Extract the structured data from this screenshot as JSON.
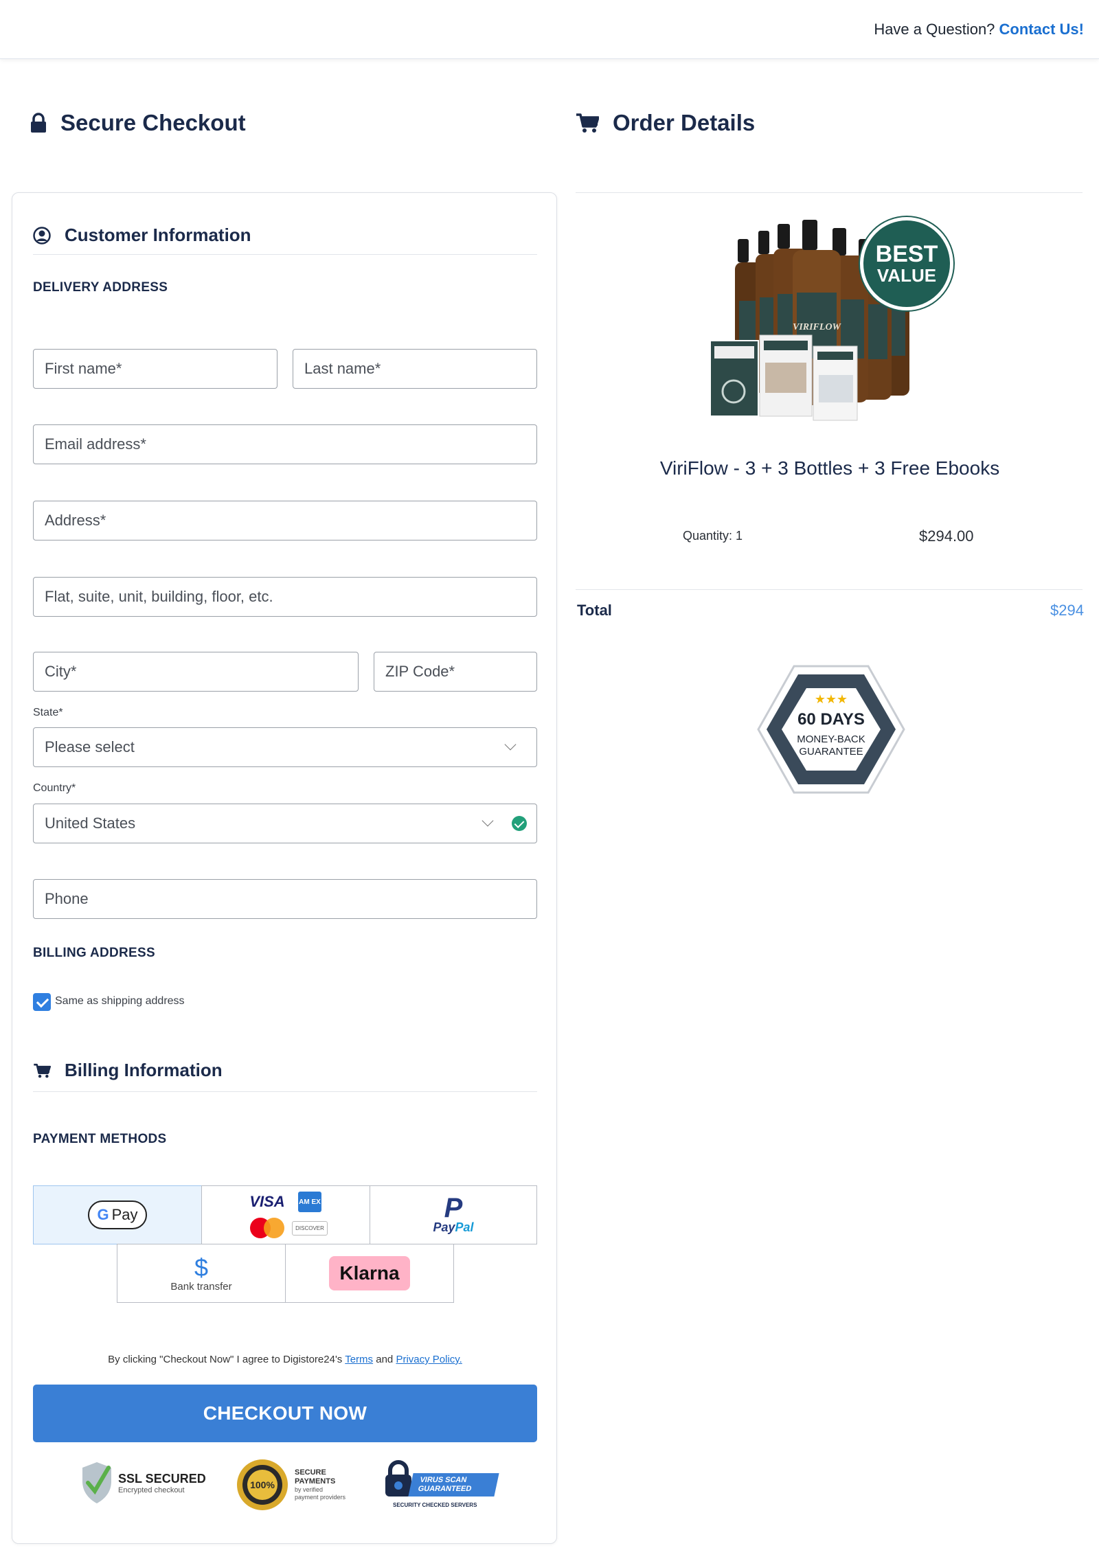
{
  "header": {
    "question": "Have a Question?",
    "contact_link": "Contact Us!"
  },
  "checkout": {
    "title": "Secure Checkout",
    "customer_info_title": "Customer Information",
    "delivery_address_label": "DELIVERY ADDRESS",
    "fields": {
      "first_name": "First name*",
      "last_name": "Last name*",
      "email": "Email address*",
      "address": "Address*",
      "address2": "Flat, suite, unit, building, floor, etc.",
      "city": "City*",
      "zip": "ZIP Code*",
      "state_label": "State*",
      "state_value": "Please select",
      "country_label": "Country*",
      "country_value": "United States",
      "phone": "Phone"
    },
    "billing_address_label": "BILLING ADDRESS",
    "same_as_shipping": "Same as shipping address",
    "same_as_shipping_checked": true,
    "billing_info_title": "Billing Information",
    "payment_methods_label": "PAYMENT METHODS",
    "payment_methods": {
      "gpay": "Pay",
      "visa": "VISA",
      "amex": "AM EX",
      "discover": "DISCOVER",
      "paypal_a": "Pay",
      "paypal_b": "Pal",
      "bank_transfer": "Bank transfer",
      "klarna": "Klarna"
    },
    "terms": {
      "prefix": "By clicking \"Checkout Now\" I agree to Digistore24's",
      "terms_link": "Terms",
      "and": "and",
      "privacy_link": "Privacy Policy."
    },
    "checkout_button": "CHECKOUT NOW",
    "badges": {
      "ssl_title": "SSL SECURED",
      "ssl_sub": "Encrypted checkout",
      "secure_line1": "SECURE",
      "secure_line2": "PAYMENTS",
      "secure_line3": "by verified",
      "secure_line4": "payment providers",
      "virus_line1": "VIRUS SCAN",
      "virus_line2": "GUARANTEED",
      "virus_sub": "SECURITY CHECKED SERVERS"
    }
  },
  "order": {
    "title": "Order Details",
    "best_value_line1": "BEST",
    "best_value_line2": "VALUE",
    "product_name": "ViriFlow - 3 + 3 Bottles + 3 Free Ebooks",
    "quantity": "Quantity: 1",
    "price": "$294.00",
    "total_label": "Total",
    "total_value": "$294",
    "guarantee_days": "60 DAYS",
    "guarantee_line1": "MONEY-BACK",
    "guarantee_line2": "GUARANTEE"
  },
  "colors": {
    "accent_blue": "#3a7fd5",
    "heading_navy": "#1b2a4a",
    "link_blue": "#1a6fd0",
    "success_green": "#22a07a",
    "badge_teal": "#1f5e54"
  }
}
